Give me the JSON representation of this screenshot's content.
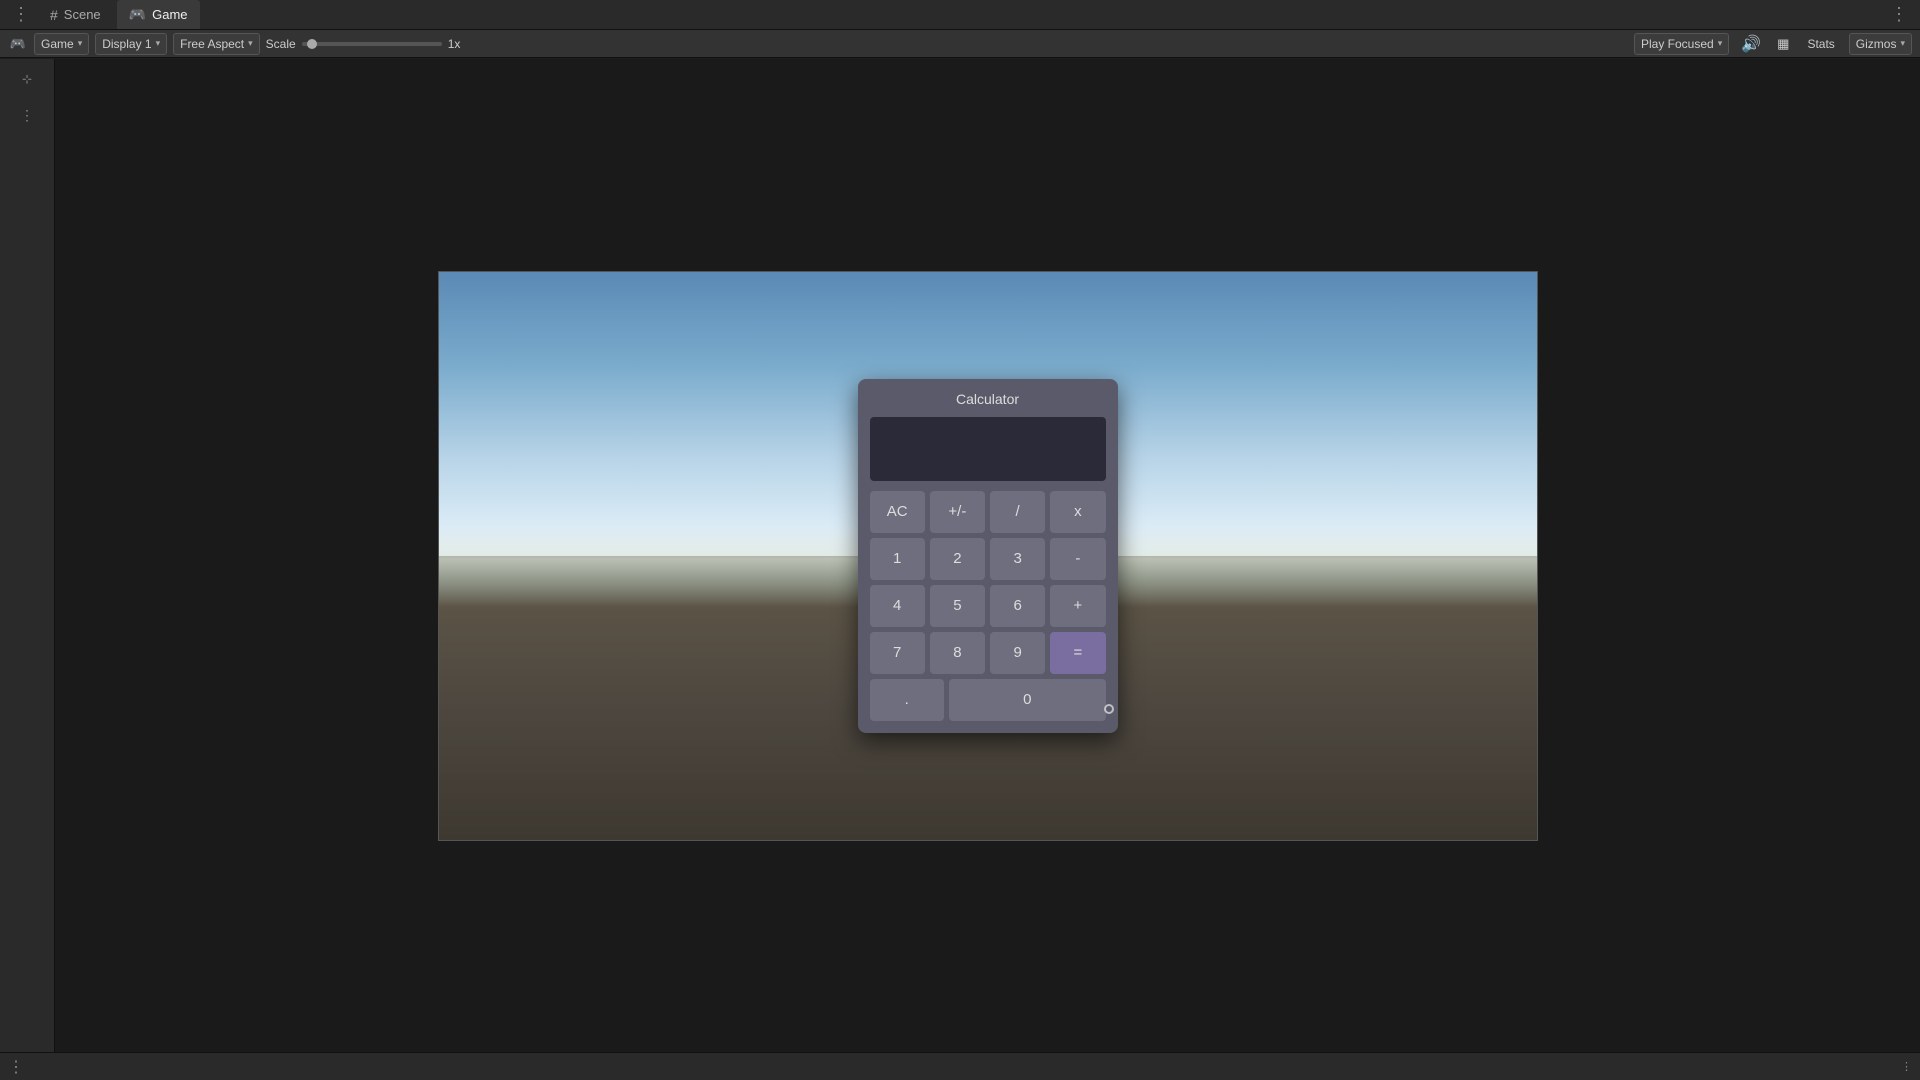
{
  "tabs": {
    "scene": {
      "label": "Scene",
      "icon": "⊞",
      "active": false
    },
    "game": {
      "label": "Game",
      "icon": "🎮",
      "active": true
    }
  },
  "toolbar": {
    "game_dropdown_label": "Game",
    "display_dropdown_label": "Display 1",
    "aspect_dropdown_label": "Free Aspect",
    "scale_label": "Scale",
    "scale_value": "1x",
    "play_focused_label": "Play Focused",
    "stats_label": "Stats",
    "gizmos_label": "Gizmos"
  },
  "calculator": {
    "title": "Calculator",
    "display_value": "",
    "buttons": {
      "row1": [
        "AC",
        "+/-",
        "/",
        "x"
      ],
      "row2": [
        "1",
        "2",
        "3",
        "-"
      ],
      "row3": [
        "4",
        "5",
        "6",
        "+"
      ],
      "row4_left": [
        "7",
        "8",
        "9"
      ],
      "equals": "=",
      "row5_dot": ".",
      "row5_zero": "0"
    }
  },
  "status_bar": {
    "dots_label": "⋮",
    "right_dots": "⋮"
  },
  "icons": {
    "dots_horiz": "⋯",
    "chevron_down": "▾",
    "sound": "🔊",
    "grid": "▦"
  }
}
